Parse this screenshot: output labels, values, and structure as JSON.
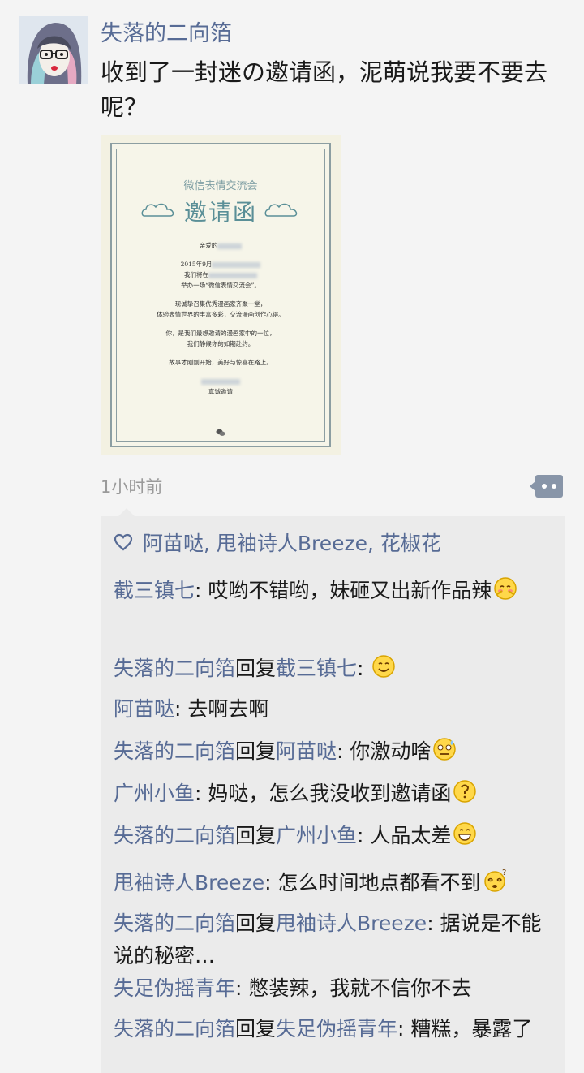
{
  "post": {
    "author": "失落的二向箔",
    "text": "收到了一封迷の邀请函，泥萌说我要不要去呢？",
    "time": "1小时前",
    "image": {
      "card_subtitle": "微信表情交流会",
      "card_title": "邀请函",
      "lines": [
        "亲爱的",
        "2015年9月",
        "我们将在",
        "举办一场“微信表情交流会”。",
        "现诚挚召集优秀漫画家齐聚一堂，",
        "体验表情世界的丰富多彩，交流漫画创作心得。",
        "你，是我们最想邀请的漫画家中的一位，",
        "我们静候你的如期赴约。",
        "故事才刚刚开始，美好与惊喜在路上。",
        "真诚邀请"
      ]
    }
  },
  "likes": {
    "icon": "heart-icon",
    "names": "阿苗哒, 甩袖诗人Breeze, 花椒花"
  },
  "comments": [
    {
      "from": "截三镇七",
      "text": ": 哎哟不错哟，妹砸又出新作品辣",
      "emoji": "shy-emoji"
    },
    {
      "from": "失落的二向箔",
      "reply_word": "回复",
      "to": "截三镇七",
      "text": ": ",
      "emoji": "smile-emoji"
    },
    {
      "from": "阿苗哒",
      "text": ": 去啊去啊"
    },
    {
      "from": "失落的二向箔",
      "reply_word": "回复",
      "to": "阿苗哒",
      "text": ": 你激动啥",
      "emoji": "sweat-emoji"
    },
    {
      "from": "广州小鱼",
      "text": ": 妈哒，怎么我没收到邀请函",
      "emoji": "question-emoji"
    },
    {
      "from": "失落的二向箔",
      "reply_word": "回复",
      "to": "广州小鱼",
      "text": ": 人品太差",
      "emoji": "grin-emoji"
    },
    {
      "from": "甩袖诗人Breeze",
      "text": ": 怎么时间地点都看不到",
      "emoji": "dizzy-emoji"
    },
    {
      "from": "失落的二向箔",
      "reply_word": "回复",
      "to": "甩袖诗人Breeze",
      "text": ": 据说是不能说的秘密…"
    },
    {
      "from": "失足伪摇青年",
      "text": ": 憋装辣，我就不信你不去"
    },
    {
      "from": "失落的二向箔",
      "reply_word": "回复",
      "to": "失足伪摇青年",
      "text": ": 糟糕，暴露了"
    }
  ],
  "colors": {
    "name_link": "#576b95",
    "comment_bg": "#ebebeb",
    "page_bg": "#f4f4f4",
    "more_button": "#8895a8"
  }
}
